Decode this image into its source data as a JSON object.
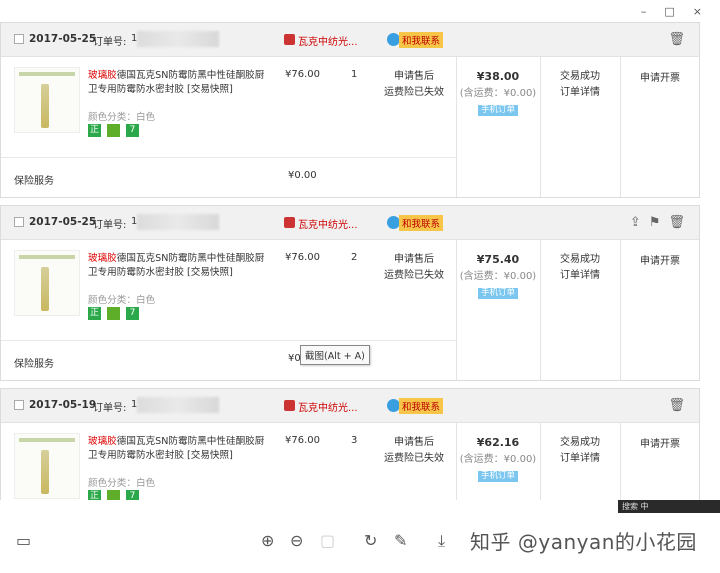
{
  "window": {
    "minimize": "–",
    "maximize": "□",
    "close": "×"
  },
  "orders": [
    {
      "date": "2017-05-25",
      "order_no_label": "订单号:",
      "order_no": "1",
      "shop": "瓦克中纺光...",
      "contact": "和我联系",
      "product_keyword": "玻璃胶",
      "product_title": "德国瓦克SN防霉防黑中性硅酮胶厨卫专用防霉防水密封胶 [交易快照]",
      "spec": "颜色分类：白色",
      "unit_price": "¥76.00",
      "quantity": "1",
      "service_1": "申请售后",
      "service_2": "运费险已失效",
      "total": "¥38.00",
      "shipping": "(含运费：¥0.00)",
      "mobile": "手机订单",
      "status_1": "交易成功",
      "status_2": "订单详情",
      "invoice": "申请开票",
      "insurance_label": "保险服务",
      "insurance_price": "¥0.00"
    },
    {
      "date": "2017-05-25",
      "order_no_label": "订单号:",
      "order_no": "1",
      "shop": "瓦克中纺光...",
      "contact": "和我联系",
      "product_keyword": "玻璃胶",
      "product_title": "德国瓦克SN防霉防黑中性硅酮胶厨卫专用防霉防水密封胶 [交易快照]",
      "spec": "颜色分类：白色",
      "unit_price": "¥76.00",
      "quantity": "2",
      "service_1": "申请售后",
      "service_2": "运费险已失效",
      "total": "¥75.40",
      "shipping": "(含运费：¥0.00)",
      "mobile": "手机订单",
      "status_1": "交易成功",
      "status_2": "订单详情",
      "invoice": "申请开票",
      "insurance_label": "保险服务",
      "insurance_price": "¥0."
    },
    {
      "date": "2017-05-19",
      "order_no_label": "订单号:",
      "order_no": "1",
      "shop": "瓦克中纺光...",
      "contact": "和我联系",
      "product_keyword": "玻璃胶",
      "product_title": "德国瓦克SN防霉防黑中性硅酮胶厨卫专用防霉防水密封胶 [交易快照]",
      "spec": "颜色分类：白色",
      "unit_price": "¥76.00",
      "quantity": "3",
      "service_1": "申请售后",
      "service_2": "运费险已失效",
      "total": "¥62.16",
      "shipping": "(含运费：¥0.00)",
      "mobile": "手机订单",
      "status_1": "交易成功",
      "status_2": "订单详情",
      "invoice": "申请开票"
    }
  ],
  "tooltip": "截图(Alt + A)",
  "badges": [
    "正",
    "",
    "7"
  ],
  "watermark": "知乎 @yanyan的小花园",
  "taskbar_text": "搜索 中"
}
